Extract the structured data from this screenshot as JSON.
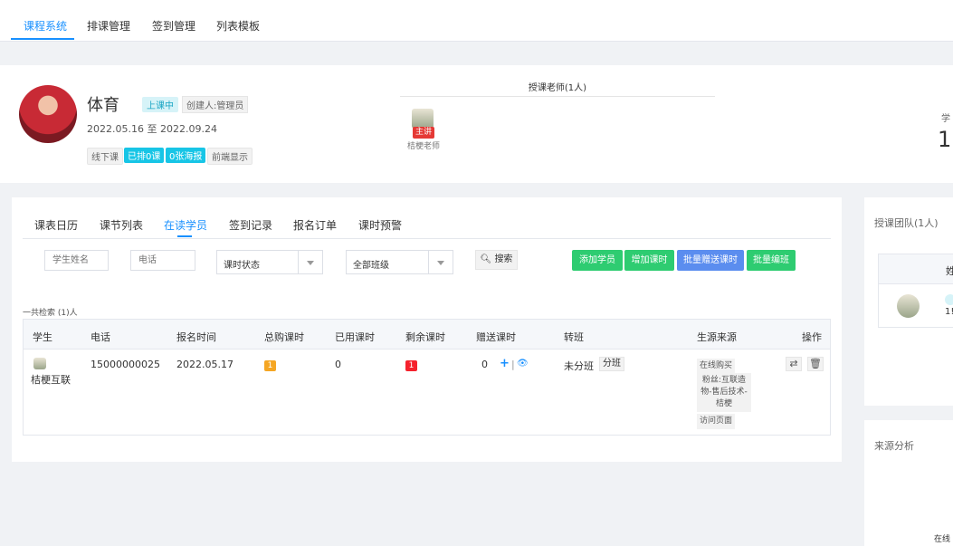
{
  "nav": {
    "tabs": [
      "课程系统",
      "排课管理",
      "签到管理",
      "列表模板"
    ],
    "active_index": 0
  },
  "course": {
    "title": "体育",
    "status": "上课中",
    "creator": "创建人:管理员",
    "dates": "2022.05.16 至 2022.09.24",
    "tags": [
      "线下课",
      "已排0课",
      "0张海报",
      "前端显示"
    ],
    "teacher_header": "授课老师(1人)",
    "teacher_role": "主讲",
    "teacher_name": "桔梗老师",
    "stat_label": "学",
    "stat_value": "1"
  },
  "subtabs": [
    "课表日历",
    "课节列表",
    "在读学员",
    "签到记录",
    "报名订单",
    "课时预警"
  ],
  "filters": {
    "name_placeholder": "学生姓名",
    "phone_placeholder": "电话",
    "status_select": "课时状态",
    "class_select": "全部班级",
    "search_label": "搜索"
  },
  "actions": {
    "add_student": "添加学员",
    "add_hours": "增加课时",
    "batch_gift": "批量赠送课时",
    "batch_class": "批量编班"
  },
  "table": {
    "count_label": "一共检索 (1)人",
    "headers": [
      "学生",
      "电话",
      "报名时间",
      "总购课时",
      "已用课时",
      "剩余课时",
      "赠送课时",
      "转班",
      "生源来源",
      "操作"
    ],
    "row": {
      "student": "桔梗互联",
      "phone": "15000000025",
      "date": "2022.05.17",
      "total": "1",
      "used": "0",
      "remaining": "1",
      "gift": "0",
      "class_status": "未分班",
      "class_btn": "分班",
      "source_lines": [
        "在线购买",
        "粉丝:互联造物-售后技术-桔梗",
        "访问页面"
      ]
    }
  },
  "right": {
    "team_title": "授课团队(1人)",
    "team_col_header": "姓",
    "team_row_value": "1!",
    "source_title": "来源分析",
    "source_bottom_label": "在线"
  },
  "colors": {
    "primary": "#1890ff",
    "green": "#2ecc71",
    "cyan": "#17c5e6",
    "orange": "#f5a623",
    "red": "#f5222d"
  }
}
